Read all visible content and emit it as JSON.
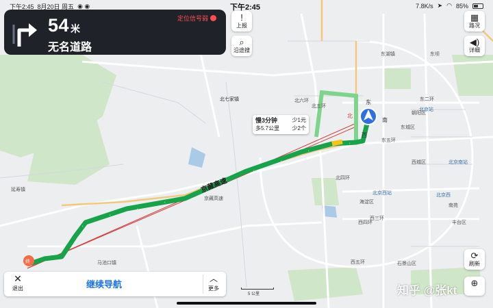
{
  "status_bar": {
    "left_time": "下午2:45",
    "date": "8月20日 周五",
    "center_time": "下午2:45",
    "network": "7.8K/s",
    "battery": "85%"
  },
  "navigation": {
    "distance": "54",
    "unit": "米",
    "road": "无名道路",
    "gps_warning": "定位信号弱"
  },
  "side_buttons": {
    "report": "上报",
    "search_along": "沿途搜",
    "traffic": "路况",
    "detail": "详细",
    "refresh": "刷新"
  },
  "route_bubble": {
    "slower": "慢3分钟",
    "toll": "少1元",
    "distance": "多5.7公里",
    "lights": "少2个"
  },
  "bottom_bar": {
    "exit": "退出",
    "continue": "继续导航",
    "more": "更多"
  },
  "scale": "5 公里",
  "watermark": "知乎 @张kt",
  "map_markers": {
    "end": "终",
    "north": "北",
    "east": "东",
    "west": "西",
    "south": "南"
  },
  "map_labels": [
    {
      "text": "北七家镇",
      "cls": "dark"
    },
    {
      "text": "东湖镇",
      "cls": ""
    },
    {
      "text": "北京站",
      "cls": "blue"
    },
    {
      "text": "北京西站",
      "cls": "blue"
    },
    {
      "text": "西城区",
      "cls": ""
    },
    {
      "text": "东城区",
      "cls": ""
    },
    {
      "text": "朝阳区",
      "cls": ""
    },
    {
      "text": "海淀区",
      "cls": ""
    },
    {
      "text": "延寿镇",
      "cls": ""
    },
    {
      "text": "马池口镇",
      "cls": ""
    },
    {
      "text": "东坝",
      "cls": ""
    },
    {
      "text": "东五环",
      "cls": ""
    },
    {
      "text": "北五环",
      "cls": ""
    },
    {
      "text": "北四环",
      "cls": ""
    },
    {
      "text": "西三环",
      "cls": ""
    },
    {
      "text": "西五环",
      "cls": ""
    },
    {
      "text": "西四环",
      "cls": ""
    },
    {
      "text": "东二环",
      "cls": ""
    },
    {
      "text": "丰台区",
      "cls": ""
    },
    {
      "text": "石景山区",
      "cls": ""
    },
    {
      "text": "京藏高速",
      "cls": ""
    },
    {
      "text": "北京南站",
      "cls": "blue"
    },
    {
      "text": "南苑",
      "cls": ""
    },
    {
      "text": "北京西",
      "cls": "blue"
    },
    {
      "text": "北六环",
      "cls": ""
    }
  ],
  "highway_name": "京藏高速"
}
